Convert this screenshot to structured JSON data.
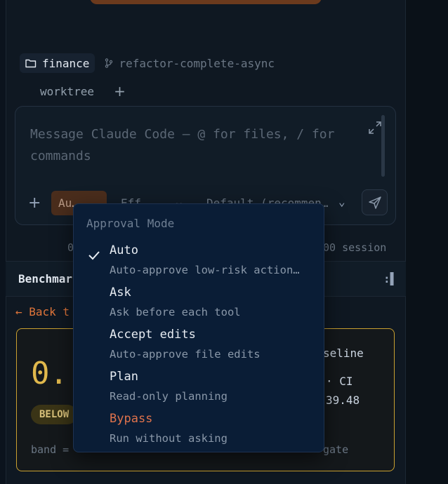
{
  "context": {
    "folder": "finance",
    "branch": "refactor-complete-async",
    "worktree": "worktree"
  },
  "composer": {
    "placeholder": "Message Claude Code — @ for files, / for commands",
    "mode_chip": "Au…",
    "effort": "Eff",
    "model": "Default (recommen…"
  },
  "status": {
    "left": "0",
    "right": "00 session"
  },
  "benchmark": {
    "title": "Benchmar",
    "back_link": "← Back t",
    "big_value": "0.",
    "badge": "BELOW",
    "band_text": "band =",
    "gate_text": "gate",
    "baseline_text": "seline",
    "ci_text": "· CI",
    "value_text": "39.48"
  },
  "approval_menu": {
    "title": "Approval Mode",
    "items": [
      {
        "label": "Auto",
        "desc": "Auto-approve low-risk action…",
        "selected": true
      },
      {
        "label": "Ask",
        "desc": "Ask before each tool",
        "selected": false
      },
      {
        "label": "Accept edits",
        "desc": "Auto-approve file edits",
        "selected": false
      },
      {
        "label": "Plan",
        "desc": "Read-only planning",
        "selected": false
      },
      {
        "label": "Bypass",
        "desc": "Run without asking",
        "selected": false
      }
    ]
  },
  "colors": {
    "accent": "#e0753a",
    "danger": "#e0734c",
    "gold": "#c9a030"
  }
}
